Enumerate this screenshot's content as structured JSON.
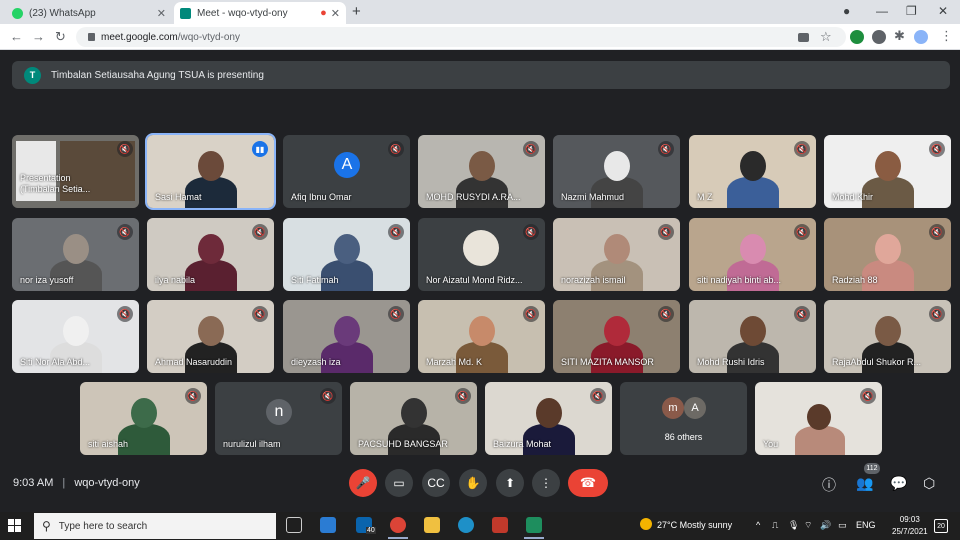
{
  "browser": {
    "tabs": [
      {
        "title": "(23) WhatsApp",
        "color": "#25d366"
      },
      {
        "title": "Meet - wqo-vtyd-ony",
        "color": "#00897b"
      }
    ],
    "url_host": "meet.google.com",
    "url_path": "/wqo-vtyd-ony"
  },
  "banner": {
    "avatar_letter": "T",
    "text": "Timbalan Setiausaha Agung TSUA is presenting"
  },
  "presentation_tile": {
    "line1": "Presentation",
    "line2": "(Timbalan Setia..."
  },
  "participants": [
    {
      "name": "Sasi Hamat",
      "bg": "#d9d2c7",
      "skin": "#6b4a3a",
      "cloth": "#1c2a3a",
      "speaking": true
    },
    {
      "name": "Afiq Ibnu Omar",
      "avatar_letter": "A",
      "avatar_color": "#1a73e8"
    },
    {
      "name": "MOHD RUSYDI A.RA...",
      "bg": "#b8b6b0",
      "skin": "#7a5a45",
      "cloth": "#333"
    },
    {
      "name": "Nazmi Mahmud",
      "bg": "#55585c",
      "skin": "#e8e8e8",
      "cloth": "#444"
    },
    {
      "name": "M Z",
      "bg": "#d7cbb8",
      "skin": "#2a2a2a",
      "cloth": "#3b5f99"
    },
    {
      "name": "Mohd Khir",
      "bg": "#efefef",
      "skin": "#8a5c42",
      "cloth": "#6b5a45"
    },
    {
      "name": "nor iza yusoff",
      "bg": "#6b6e72",
      "skin": "#9a8f85",
      "cloth": "#555"
    },
    {
      "name": "ilya nabila",
      "bg": "#cfcac2",
      "skin": "#6e2a3a",
      "cloth": "#5a2030"
    },
    {
      "name": "Siti Fatimah",
      "bg": "#d8dfe2",
      "skin": "#4a5f80",
      "cloth": "#3a4f70"
    },
    {
      "name": "Nor Aizatul Mond Ridz...",
      "avatar_photo": true,
      "bg": "#3c4043"
    },
    {
      "name": "norazizah ismail",
      "bg": "#c9c0b5",
      "skin": "#b08a78",
      "cloth": "#a3927e"
    },
    {
      "name": "siti nadiyah binti ab...",
      "bg": "#b9a58d",
      "skin": "#d98bb0",
      "cloth": "#c06b95"
    },
    {
      "name": "Radziah 88",
      "bg": "#a8927a",
      "skin": "#e0a79a",
      "cloth": "#c98a80"
    },
    {
      "name": "Siti Nor Ala Abd...",
      "bg": "#e3e4e6",
      "skin": "#f0f0f0",
      "cloth": "#ddd"
    },
    {
      "name": "Ahmad Nasaruddin",
      "bg": "#d3cdc4",
      "skin": "#8a6a55",
      "cloth": "#222"
    },
    {
      "name": "dieyzash iza",
      "bg": "#9a9690",
      "skin": "#6a3a7a",
      "cloth": "#5a2a6a"
    },
    {
      "name": "Marzah Md. K",
      "bg": "#c7bfb0",
      "skin": "#c78a6a",
      "cloth": "#7a5a3a"
    },
    {
      "name": "SITI MAZITA MANSOR",
      "bg": "#8d8070",
      "skin": "#b02a3a",
      "cloth": "#8a1a2a"
    },
    {
      "name": "Mohd Rushi Idris",
      "bg": "#bdb7ad",
      "skin": "#6e4a35",
      "cloth": "#333"
    },
    {
      "name": "RajaAbdul Shukor R...",
      "bg": "#c8c2b8",
      "skin": "#7a5a45",
      "cloth": "#222"
    },
    {
      "name": "siti aishah",
      "bg": "#cdc5b8",
      "skin": "#3d6b4a",
      "cloth": "#2e5a3a"
    },
    {
      "name": "nurulizul ilham",
      "avatar_letter": "n",
      "avatar_color": "#5f6368"
    },
    {
      "name": "PACSUHD BANGSAR",
      "bg": "#b7b3a8",
      "skin": "#333",
      "cloth": "#2a2a2a"
    },
    {
      "name": "Baizura Mohat",
      "bg": "#dcd8d0",
      "skin": "#5a3a2a",
      "cloth": "#1a1a3a"
    }
  ],
  "others": {
    "label": "86 others",
    "avatars": [
      {
        "letter": "m",
        "color": "#8a5a4a"
      },
      {
        "letter": "A",
        "color": "#6d6a65"
      }
    ]
  },
  "self_tile": {
    "name": "You",
    "bg": "#e5e2dc",
    "skin": "#5a3a2a",
    "cloth": "#b88a7a"
  },
  "meeting": {
    "time": "9:03 AM",
    "separator": "|",
    "code": "wqo-vtyd-ony",
    "participant_count": "112"
  },
  "controls": [
    {
      "name": "mic-off-button",
      "glyph": "🎤",
      "red": true
    },
    {
      "name": "camera-button",
      "glyph": "▭"
    },
    {
      "name": "captions-button",
      "glyph": "CC"
    },
    {
      "name": "raise-hand-button",
      "glyph": "✋"
    },
    {
      "name": "present-button",
      "glyph": "⬆"
    },
    {
      "name": "more-options-button",
      "glyph": "⋮"
    }
  ],
  "taskbar": {
    "search_placeholder": "Type here to search",
    "weather": "27°C  Mostly sunny",
    "lang": "ENG",
    "time": "09:03",
    "date": "25/7/2021",
    "notif_count": "20",
    "mail_badge": "40"
  }
}
